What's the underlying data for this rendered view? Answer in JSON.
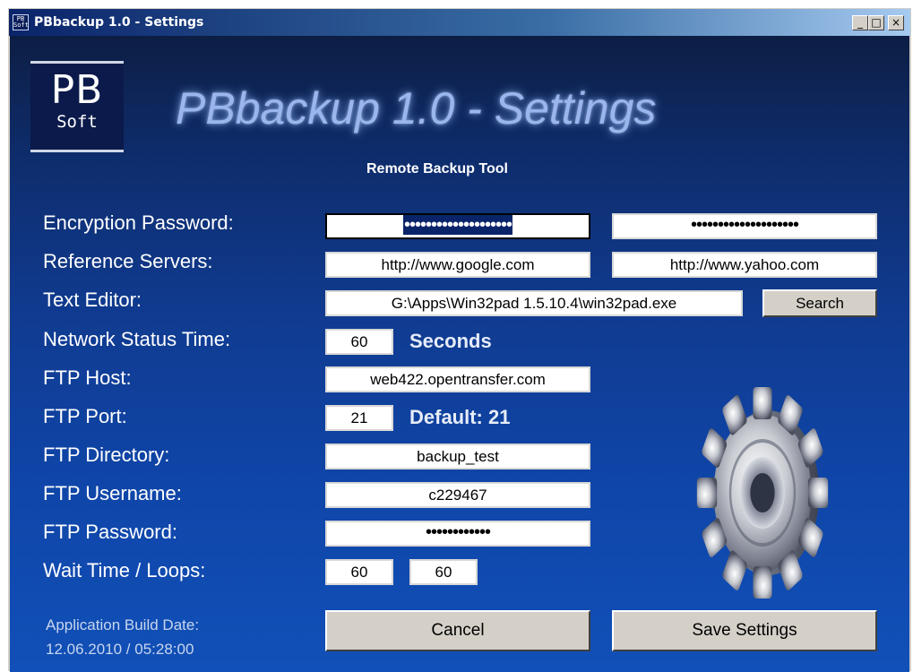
{
  "window": {
    "title": "PBbackup 1.0 - Settings",
    "icon_text": "PB Soft",
    "minimize_glyph": "_",
    "maximize_glyph": "□",
    "close_glyph": "×"
  },
  "header": {
    "logo_top": "PB",
    "logo_bottom": "Soft",
    "title": "PBbackup 1.0 - Settings",
    "subtitle": "Remote Backup Tool"
  },
  "form": {
    "encryption_password_label": "Encryption Password:",
    "encryption_password_1": "••••••••••••••••••••",
    "encryption_password_2": "••••••••••••••••••••",
    "reference_servers_label": "Reference Servers:",
    "reference_server_1": "http://www.google.com",
    "reference_server_2": "http://www.yahoo.com",
    "text_editor_label": "Text Editor:",
    "text_editor_path": "G:\\Apps\\Win32pad 1.5.10.4\\win32pad.exe",
    "search_button": "Search",
    "network_status_label": "Network Status Time:",
    "network_status_value": "60",
    "network_status_unit": "Seconds",
    "ftp_host_label": "FTP Host:",
    "ftp_host_value": "web422.opentransfer.com",
    "ftp_port_label": "FTP Port:",
    "ftp_port_value": "21",
    "ftp_port_default": "Default: 21",
    "ftp_directory_label": "FTP Directory:",
    "ftp_directory_value": "backup_test",
    "ftp_username_label": "FTP Username:",
    "ftp_username_value": "c229467",
    "ftp_password_label": "FTP Password:",
    "ftp_password_value": "••••••••••••",
    "wait_label": "Wait Time / Loops:",
    "wait_time_value": "60",
    "loops_value": "60"
  },
  "footer": {
    "build_label": "Application Build Date:",
    "build_value": "12.06.2010 / 05:28:00",
    "cancel_button": "Cancel",
    "save_button": "Save Settings"
  },
  "icons": [
    "app-icon",
    "gear-icon"
  ],
  "colors": {
    "background_top": "#0d1e44",
    "background_bottom": "#1150b8",
    "title_glow": "#9ab6ec",
    "button_face": "#d4d0c8"
  }
}
